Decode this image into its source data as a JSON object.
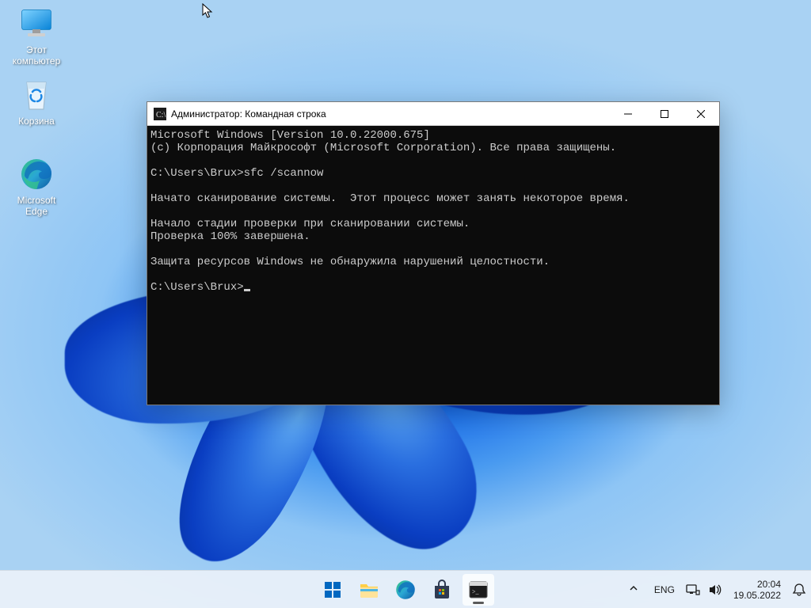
{
  "desktop": {
    "icons": [
      {
        "name": "this-pc",
        "label": "Этот\nкомпьютер"
      },
      {
        "name": "recycle-bin",
        "label": "Корзина"
      },
      {
        "name": "edge",
        "label": "Microsoft\nEdge"
      }
    ]
  },
  "window": {
    "title": "Администратор: Командная строка",
    "terminal_lines": [
      "Microsoft Windows [Version 10.0.22000.675]",
      "(c) Корпорация Майкрософт (Microsoft Corporation). Все права защищены.",
      "",
      "C:\\Users\\Brux>sfc /scannow",
      "",
      "Начато сканирование системы.  Этот процесс может занять некоторое время.",
      "",
      "Начало стадии проверки при сканировании системы.",
      "Проверка 100% завершена.",
      "",
      "Защита ресурсов Windows не обнаружила нарушений целостности.",
      "",
      "C:\\Users\\Brux>"
    ]
  },
  "taskbar": {
    "items": [
      {
        "name": "start"
      },
      {
        "name": "file-explorer"
      },
      {
        "name": "edge"
      },
      {
        "name": "microsoft-store"
      },
      {
        "name": "command-prompt",
        "active": true
      }
    ],
    "tray": {
      "lang": "ENG",
      "time": "20:04",
      "date": "19.05.2022"
    }
  },
  "colors": {
    "accent": "#0067c0",
    "terminal_bg": "#0c0c0c",
    "terminal_fg": "#cccccc"
  }
}
